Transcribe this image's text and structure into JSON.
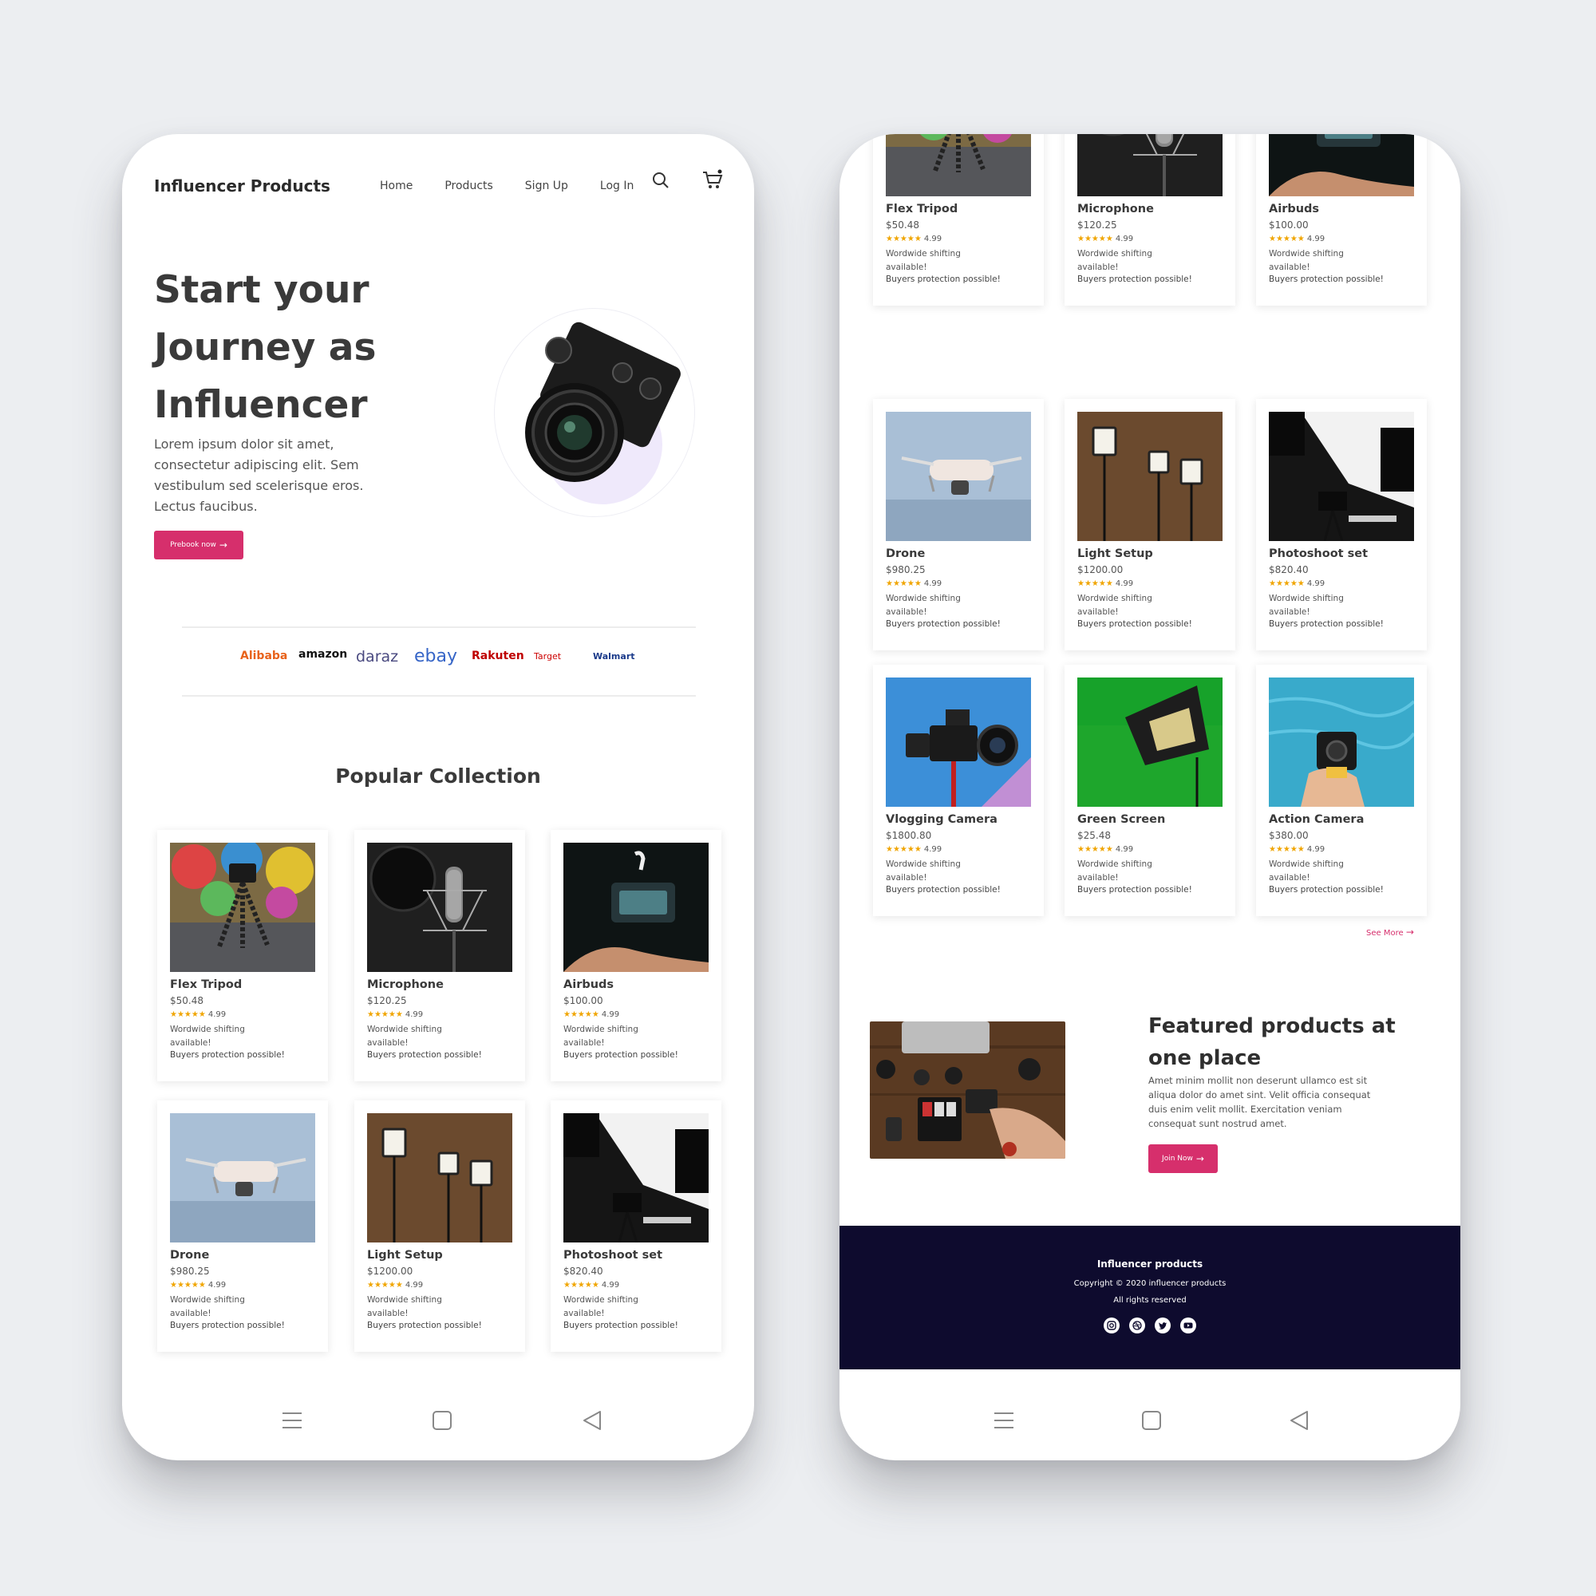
{
  "brand": "Influencer Products",
  "nav": {
    "links": [
      "Home",
      "Products",
      "Sign Up",
      "Log In"
    ]
  },
  "hero": {
    "title_lines": [
      "Start your",
      "Journey as",
      "Influencer"
    ],
    "text": "Lorem ipsum dolor sit amet, consectetur adipiscing elit. Sem vestibulum sed scelerisque eros. Lectus faucibus.",
    "button": "Prebook now"
  },
  "partners": [
    "Alibaba",
    "amazon",
    "daraz",
    "ebay",
    "Rakuten",
    "Target",
    "Walmart"
  ],
  "collection_title": "Popular Collection",
  "products_left": [
    {
      "name": "Flex Tripod",
      "price": "$50.48",
      "rating": "4.99"
    },
    {
      "name": "Microphone",
      "price": "$120.25",
      "rating": "4.99"
    },
    {
      "name": "Airbuds",
      "price": "$100.00",
      "rating": "4.99"
    },
    {
      "name": "Drone",
      "price": "$980.25",
      "rating": "4.99"
    },
    {
      "name": "Light Setup",
      "price": "$1200.00",
      "rating": "4.99"
    },
    {
      "name": "Photoshoot set",
      "price": "$820.40",
      "rating": "4.99"
    }
  ],
  "products_right": [
    {
      "name": "Flex Tripod",
      "price": "$50.48",
      "rating": "4.99"
    },
    {
      "name": "Microphone",
      "price": "$120.25",
      "rating": "4.99"
    },
    {
      "name": "Airbuds",
      "price": "$100.00",
      "rating": "4.99"
    },
    {
      "name": "Drone",
      "price": "$980.25",
      "rating": "4.99"
    },
    {
      "name": "Light Setup",
      "price": "$1200.00",
      "rating": "4.99"
    },
    {
      "name": "Photoshoot set",
      "price": "$820.40",
      "rating": "4.99"
    },
    {
      "name": "Vlogging Camera",
      "price": "$1800.80",
      "rating": "4.99"
    },
    {
      "name": "Green Screen",
      "price": "$25.48",
      "rating": "4.99"
    },
    {
      "name": "Action Camera",
      "price": "$380.00",
      "rating": "4.99"
    }
  ],
  "card_text": {
    "stars": "★★★★★",
    "shipping": "Wordwide shifting available!",
    "protection": "Buyers protection possible!"
  },
  "see_more": "See More",
  "featured": {
    "title": "Featured products at one place",
    "text": "Amet minim mollit non deserunt ullamco est sit aliqua dolor do amet sint. Velit officia consequat duis enim velit mollit. Exercitation veniam consequat sunt nostrud amet.",
    "button": "Join Now"
  },
  "footer": {
    "title": "Influencer products",
    "copyright": "Copyright © 2020 influencer products",
    "rights": "All rights reserved",
    "socials": [
      "instagram-icon",
      "dribbble-icon",
      "twitter-icon",
      "youtube-icon"
    ]
  },
  "colors": {
    "accent": "#d62f6c",
    "footer_bg": "#0e0b2e",
    "star": "#f0a500",
    "background": "#eceef1"
  }
}
